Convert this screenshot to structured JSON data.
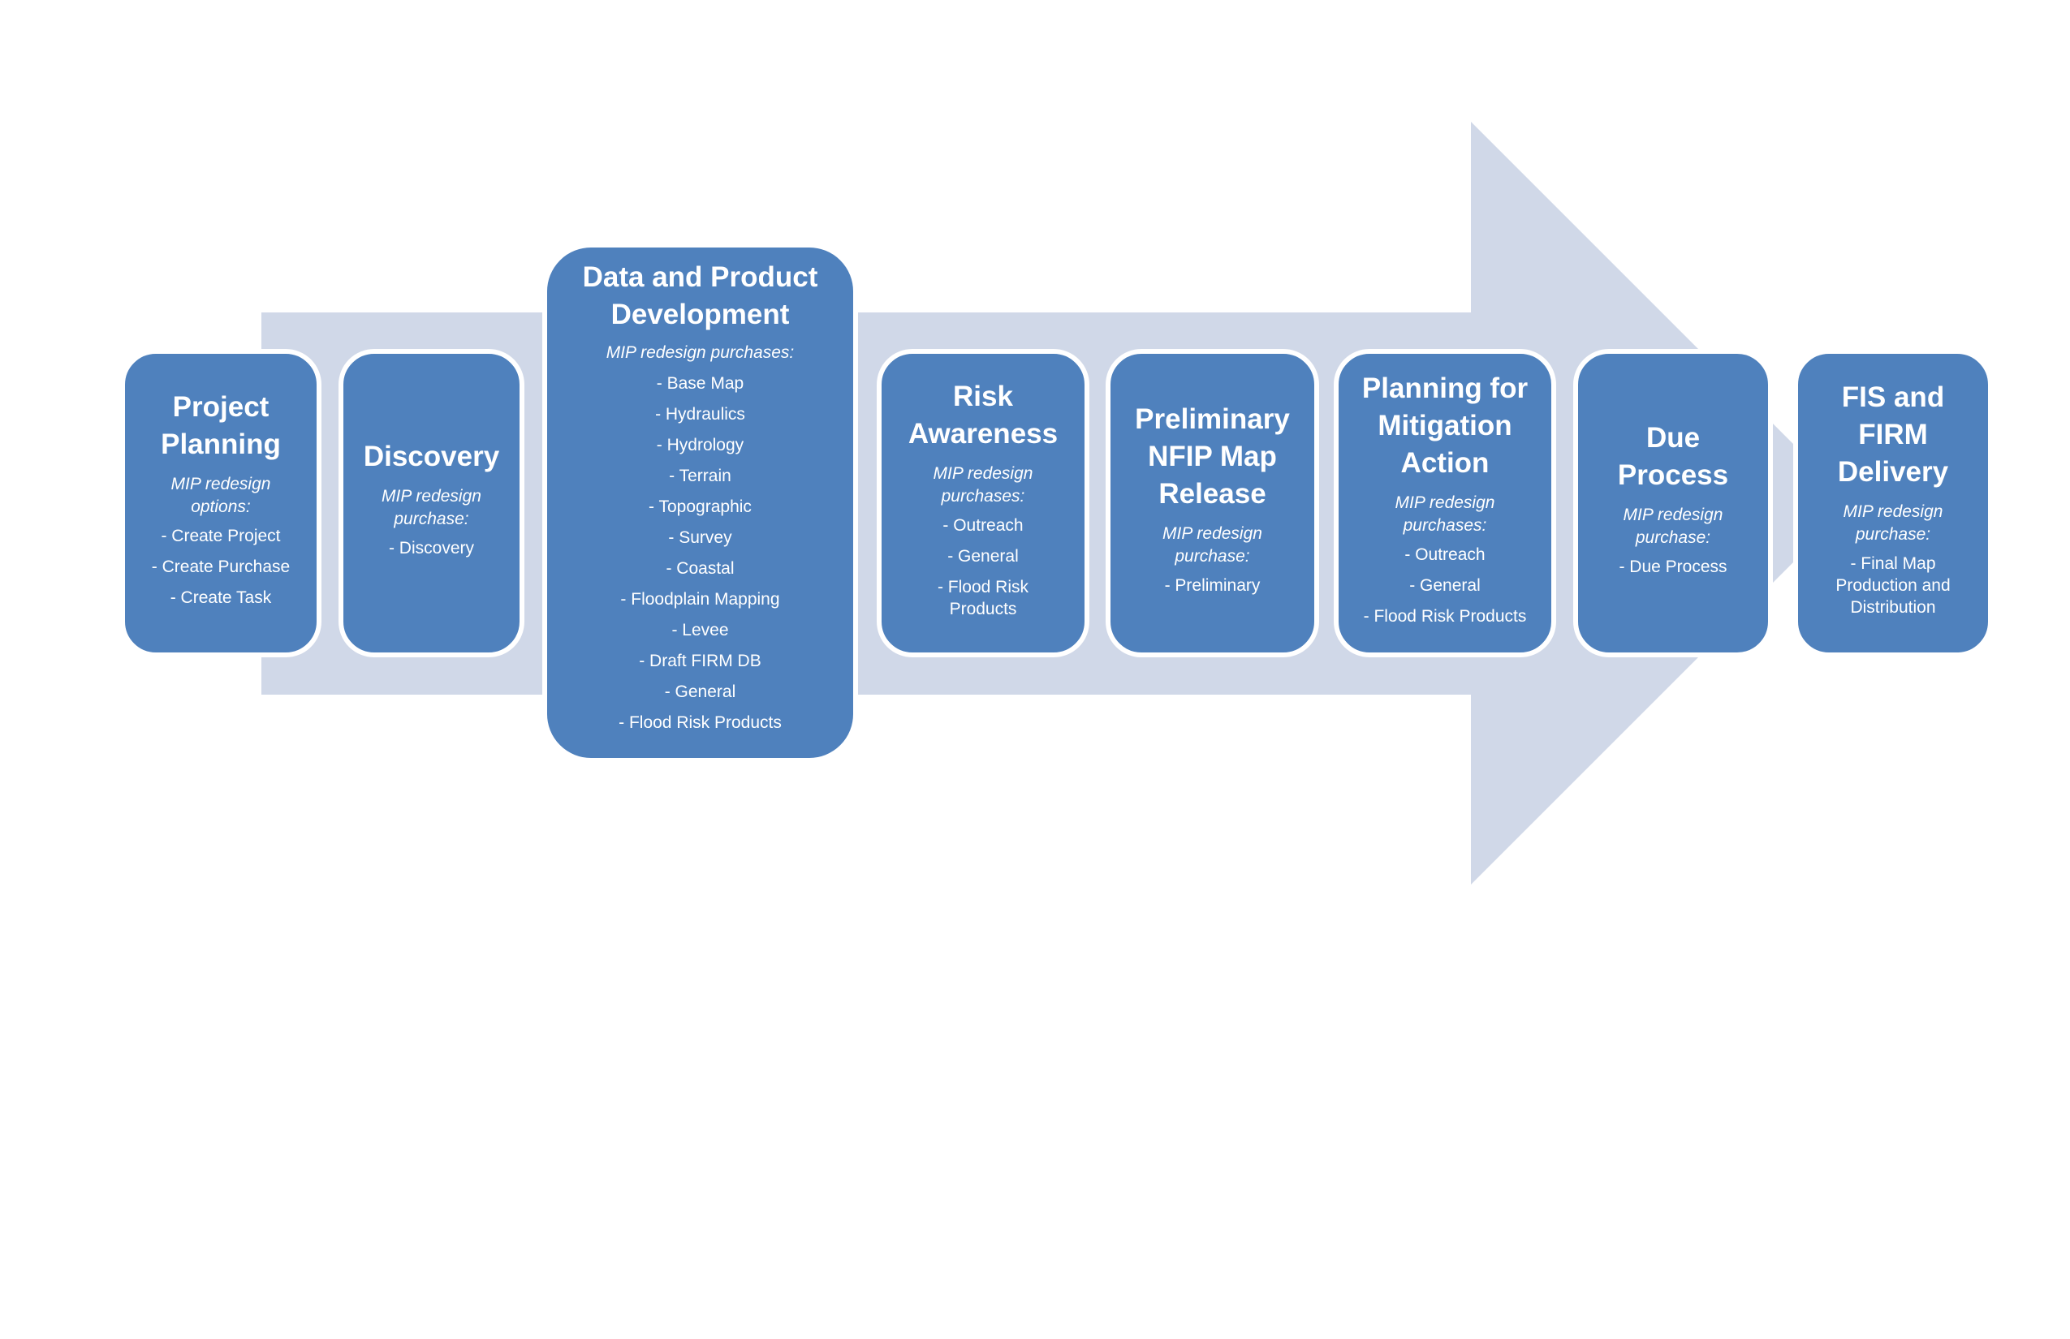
{
  "colors": {
    "stage_fill": "#4f81bd",
    "arrow_fill": "#d0d8e8",
    "text": "#ffffff",
    "outline": "#ffffff"
  },
  "arrow": {
    "icon": "right-arrow-icon",
    "direction": "right"
  },
  "stages": [
    {
      "title": "Project\nPlanning",
      "subtitle": "MIP redesign\noptions:",
      "items": [
        "- Create  Project",
        "- Create Purchase",
        "- Create Task"
      ]
    },
    {
      "title": "Discovery",
      "subtitle": "MIP redesign\npurchase:",
      "items": [
        "- Discovery"
      ]
    },
    {
      "title": "Data and Product\nDevelopment",
      "subtitle": "MIP redesign purchases:",
      "items": [
        "- Base Map",
        "- Hydraulics",
        "- Hydrology",
        "- Terrain",
        "- Topographic",
        "- Survey",
        "- Coastal",
        "- Floodplain Mapping",
        "- Levee",
        "- Draft FIRM DB",
        "- General",
        "- Flood Risk Products"
      ]
    },
    {
      "title": "Risk\nAwareness",
      "subtitle": "MIP redesign\npurchases:",
      "items": [
        "- Outreach",
        "- General",
        "- Flood Risk\nProducts"
      ]
    },
    {
      "title": "Preliminary\nNFIP Map\nRelease",
      "subtitle": "MIP redesign\npurchase:",
      "items": [
        "- Preliminary"
      ]
    },
    {
      "title": "Planning for\nMitigation\nAction",
      "subtitle": "MIP redesign\npurchases:",
      "items": [
        "- Outreach",
        "- General",
        "- Flood Risk Products"
      ]
    },
    {
      "title": "Due\nProcess",
      "subtitle": "MIP redesign\npurchase:",
      "items": [
        "- Due Process"
      ]
    },
    {
      "title": "FIS and\nFIRM\nDelivery",
      "subtitle": "MIP redesign\npurchase:",
      "items": [
        "- Final Map\nProduction and\nDistribution"
      ]
    }
  ]
}
